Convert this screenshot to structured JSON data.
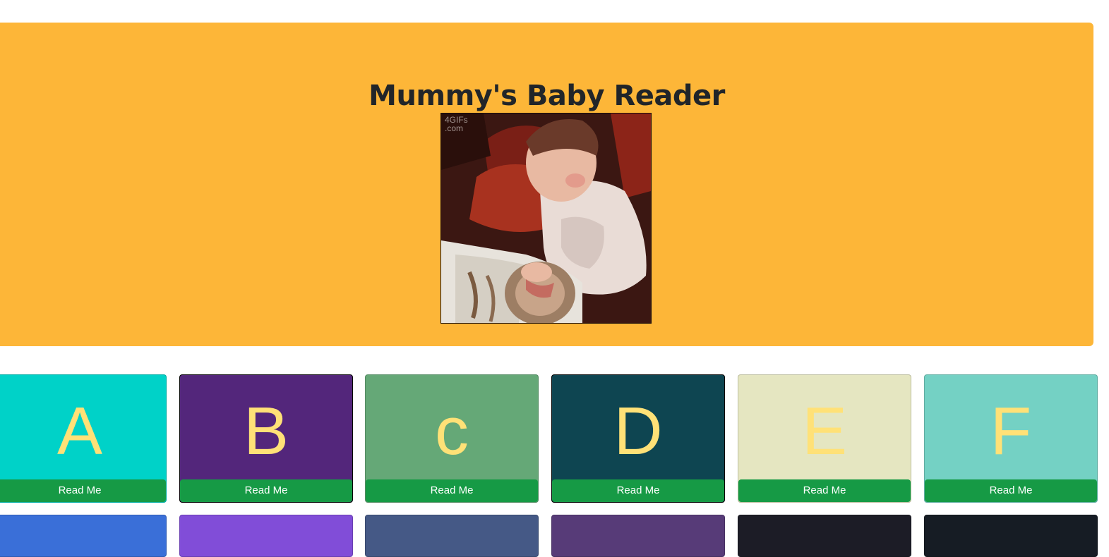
{
  "hero": {
    "title": "Mummy's Baby Reader",
    "image_watermark_line1": "4GIFs",
    "image_watermark_line2": ".com",
    "background_color": "#FDB638"
  },
  "cards_row1": [
    {
      "letter": "A",
      "button_label": "Read Me",
      "color": "#00D2C8"
    },
    {
      "letter": "B",
      "button_label": "Read Me",
      "color": "#53267B"
    },
    {
      "letter": "c",
      "button_label": "Read Me",
      "color": "#65A877"
    },
    {
      "letter": "D",
      "button_label": "Read Me",
      "color": "#0E4551"
    },
    {
      "letter": "E",
      "button_label": "Read Me",
      "color": "#E5E6C1"
    },
    {
      "letter": "F",
      "button_label": "Read Me",
      "color": "#74D1C4"
    }
  ],
  "cards_row2": [
    {
      "color": "#3A6FD8"
    },
    {
      "color": "#814DD8"
    },
    {
      "color": "#455986"
    },
    {
      "color": "#573B78"
    },
    {
      "color": "#1C1C26"
    },
    {
      "color": "#161C24"
    }
  ],
  "button_color": "#169A45",
  "letter_color": "#FFE177"
}
